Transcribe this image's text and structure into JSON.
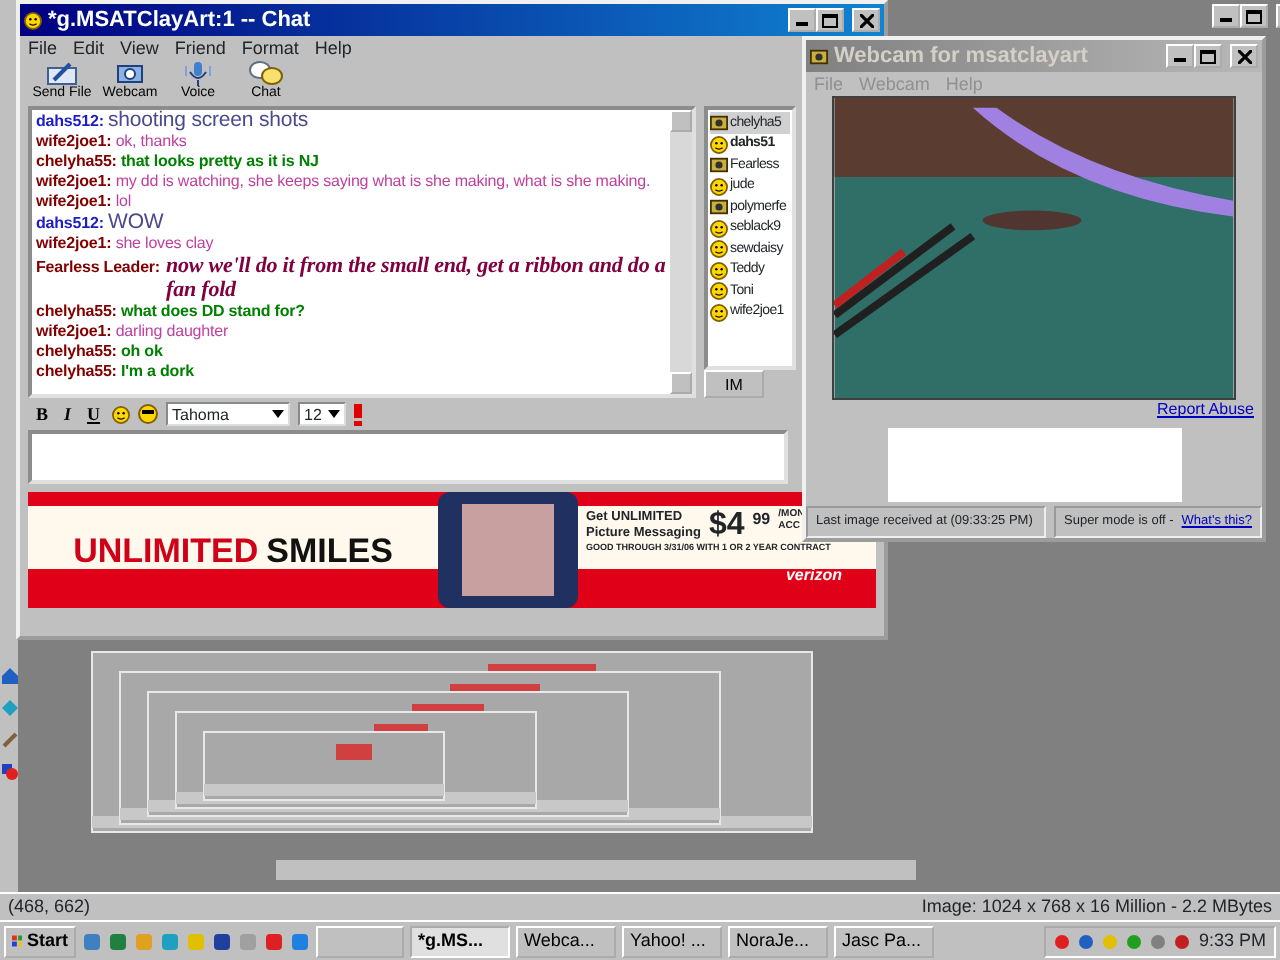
{
  "chat_window": {
    "title": "*g.MSATClayArt:1 -- Chat",
    "menu": [
      "File",
      "Edit",
      "View",
      "Friend",
      "Format",
      "Help"
    ],
    "toolbar": [
      {
        "label": "Send File",
        "kind": "pen"
      },
      {
        "label": "Webcam",
        "kind": "camera"
      },
      {
        "label": "Voice",
        "kind": "mic"
      },
      {
        "label": "Chat",
        "kind": "bubbles"
      }
    ],
    "messages": [
      {
        "sender": {
          "name": "dahs512:",
          "color": "#1c1cc8"
        },
        "text": "shooting screen shots",
        "kind": "large",
        "color": "#4a4a8c"
      },
      {
        "sender": {
          "name": "wife2joe1:",
          "color": "#800000"
        },
        "text": "ok, thanks",
        "kind": "plain",
        "color": "#c040a0"
      },
      {
        "sender": {
          "name": "chelyha55:",
          "color": "#800000"
        },
        "text": "that looks pretty as it is NJ",
        "kind": "bold",
        "color": "#008000"
      },
      {
        "sender": {
          "name": "wife2joe1:",
          "color": "#800000"
        },
        "text": "my dd is watching, she keeps saying what is she making, what is she making.",
        "kind": "plain",
        "color": "#c040a0"
      },
      {
        "sender": {
          "name": "wife2joe1:",
          "color": "#800000"
        },
        "text": "lol",
        "kind": "plain",
        "color": "#c040a0"
      },
      {
        "sender": {
          "name": "dahs512:",
          "color": "#1c1cc8"
        },
        "text": "WOW",
        "kind": "large",
        "color": "#4a4a8c"
      },
      {
        "sender": {
          "name": "wife2joe1:",
          "color": "#800000"
        },
        "text": "she loves clay",
        "kind": "plain",
        "color": "#c040a0"
      },
      {
        "sender": {
          "name": "Fearless Leader:",
          "color": "#800000"
        },
        "text": "now we'll do it from the small end, get a ribbon and do a fan fold",
        "kind": "script",
        "color": "#800040"
      },
      {
        "sender": {
          "name": "chelyha55:",
          "color": "#800000"
        },
        "text": "what does DD stand for?",
        "kind": "bold",
        "color": "#008000"
      },
      {
        "sender": {
          "name": "wife2joe1:",
          "color": "#800000"
        },
        "text": "darling daughter",
        "kind": "plain",
        "color": "#c040a0"
      },
      {
        "sender": {
          "name": "chelyha55:",
          "color": "#800000"
        },
        "text": "oh ok",
        "kind": "bold",
        "color": "#008000"
      },
      {
        "sender": {
          "name": "chelyha55:",
          "color": "#800000"
        },
        "text": "I'm a dork",
        "kind": "bold",
        "color": "#008000"
      }
    ],
    "buddies": [
      {
        "name": "chelyha5",
        "kind": "webcam",
        "selected": true,
        "bold": false
      },
      {
        "name": "dahs51",
        "kind": "smiley",
        "selected": false,
        "bold": true
      },
      {
        "name": "Fearless",
        "kind": "webcam",
        "selected": false,
        "bold": false
      },
      {
        "name": "jude",
        "kind": "smiley",
        "selected": false,
        "bold": false
      },
      {
        "name": "polymerfe",
        "kind": "webcam",
        "selected": false,
        "bold": false
      },
      {
        "name": "seblack9",
        "kind": "smiley",
        "selected": false,
        "bold": false
      },
      {
        "name": "sewdaisy",
        "kind": "smiley",
        "selected": false,
        "bold": false
      },
      {
        "name": "Teddy",
        "kind": "smiley",
        "selected": false,
        "bold": false
      },
      {
        "name": "Toni",
        "kind": "smiley",
        "selected": false,
        "bold": false
      },
      {
        "name": "wife2joe1",
        "kind": "smiley",
        "selected": false,
        "bold": false
      }
    ],
    "im_button": "IM",
    "format_buttons": [
      "B",
      "I",
      "U"
    ],
    "font": "Tahoma",
    "font_size": "12",
    "ad": {
      "headline_1": "UNLIMITED",
      "headline_2": "SMILES",
      "offer_1": "Get UNLIMITED",
      "offer_2": "Picture Messaging",
      "price": "$4",
      "cents": "99",
      "per": "/MON",
      "acc": "ACC",
      "fine_print": "GOOD THROUGH 3/31/06 WITH 1 OR 2 YEAR CONTRACT",
      "brand": "verizon"
    }
  },
  "webcam_window": {
    "title": "Webcam for msatclayart",
    "menu": [
      "File",
      "Webcam",
      "Help"
    ],
    "report_link": "Report Abuse",
    "status": "Last image received at (09:33:25 PM)",
    "super_mode": "Super mode is off -",
    "whats_this": "What's this?"
  },
  "viewer_status": {
    "coords": "(468, 662)",
    "image_info": "Image: 1024 x 768 x 16 Million - 2.2 MBytes"
  },
  "taskbar": {
    "start": "Start",
    "tasks": [
      {
        "kind": "blank",
        "selected": false
      },
      {
        "kind": "app",
        "label": "*g.MS...",
        "selected": true
      },
      {
        "kind": "app",
        "label": "Webca...",
        "selected": false
      },
      {
        "kind": "app",
        "label": "Yahoo! ...",
        "selected": false
      },
      {
        "kind": "app",
        "label": "NoraJe...",
        "selected": false
      },
      {
        "kind": "app",
        "label": "Jasc Pa...",
        "selected": false
      }
    ],
    "clock": "9:33 PM"
  }
}
